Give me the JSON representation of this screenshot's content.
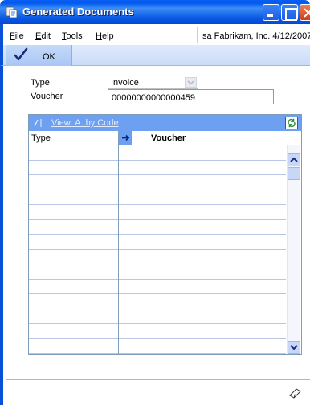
{
  "window": {
    "title": "Generated Documents",
    "accent_color": "#0a5ef3"
  },
  "menu": {
    "items": [
      {
        "label": "File",
        "accel": "F",
        "rest": "ile"
      },
      {
        "label": "Edit",
        "accel": "E",
        "rest": "dit"
      },
      {
        "label": "Tools",
        "accel": "T",
        "rest": "ools"
      },
      {
        "label": "Help",
        "accel": "H",
        "rest": "elp"
      }
    ],
    "status": "sa  Fabrikam, Inc.  4/12/2007"
  },
  "toolbar": {
    "ok_label": "OK"
  },
  "form": {
    "type_label": "Type",
    "type_value": "Invoice",
    "voucher_label": "Voucher",
    "voucher_value": "00000000000000459"
  },
  "grid": {
    "title": "View: A..by Code",
    "columns": [
      "Type",
      "Voucher"
    ],
    "rows": [
      {
        "type": "",
        "voucher": ""
      },
      {
        "type": "",
        "voucher": ""
      },
      {
        "type": "",
        "voucher": ""
      },
      {
        "type": "",
        "voucher": ""
      },
      {
        "type": "",
        "voucher": ""
      },
      {
        "type": "",
        "voucher": ""
      },
      {
        "type": "",
        "voucher": ""
      },
      {
        "type": "",
        "voucher": ""
      },
      {
        "type": "",
        "voucher": ""
      },
      {
        "type": "",
        "voucher": ""
      },
      {
        "type": "",
        "voucher": ""
      },
      {
        "type": "",
        "voucher": ""
      },
      {
        "type": "",
        "voucher": ""
      },
      {
        "type": "",
        "voucher": ""
      }
    ]
  },
  "icons": {
    "app": "document-icon",
    "ok": "check-icon",
    "refresh": "refresh-icon",
    "note": "note-icon"
  }
}
